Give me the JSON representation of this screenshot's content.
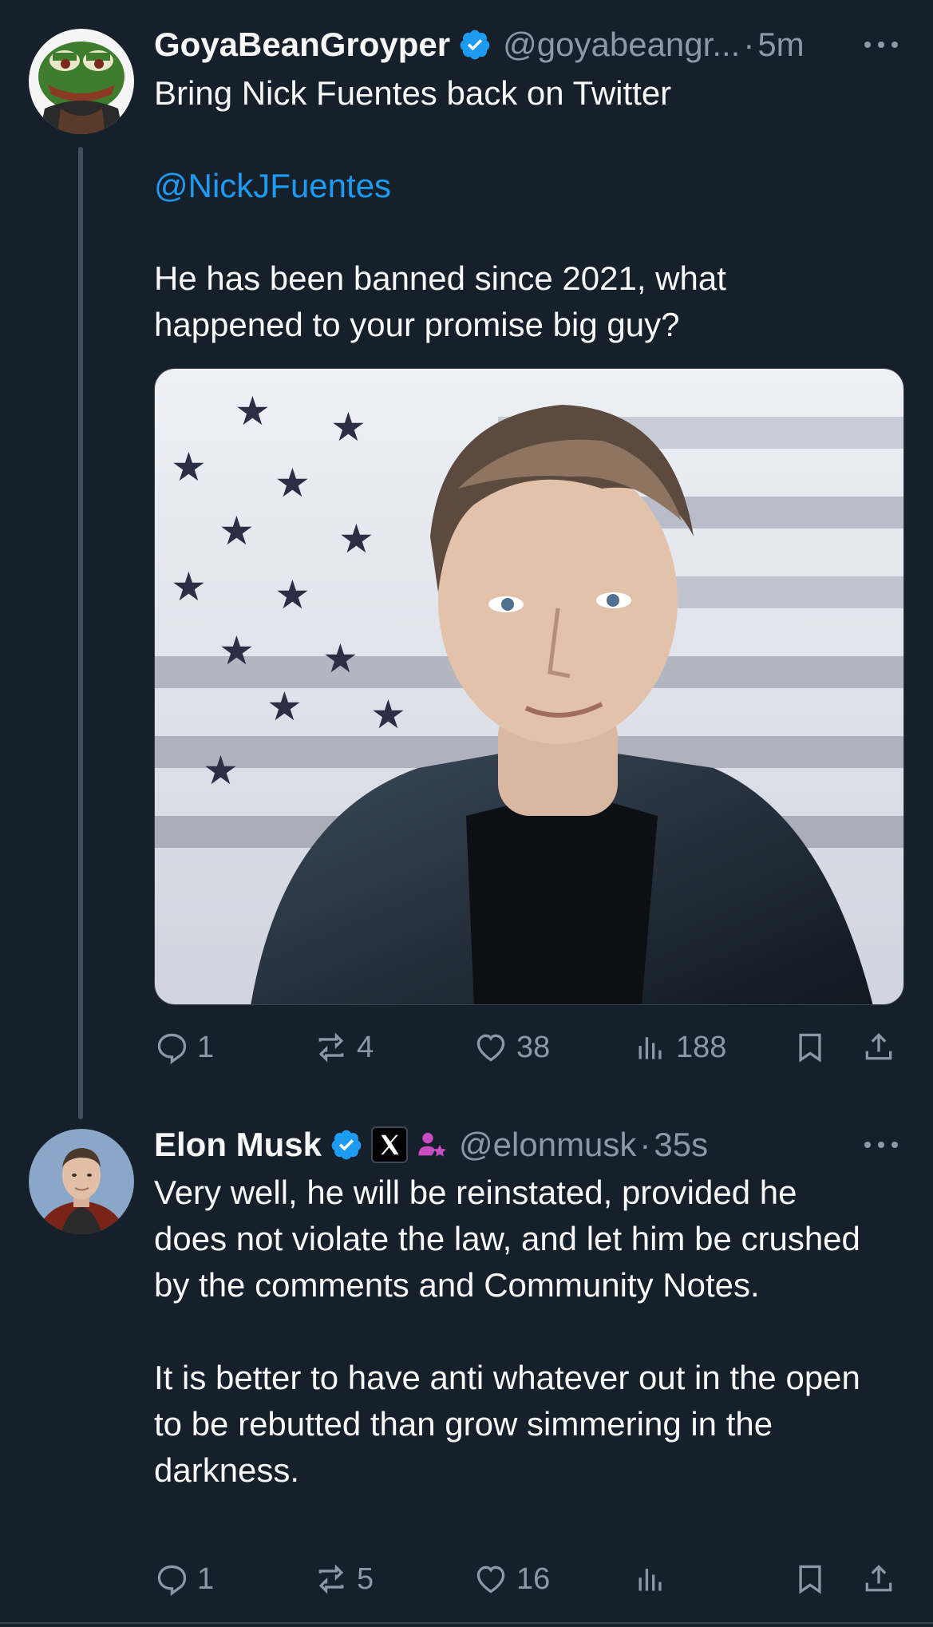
{
  "tweets": [
    {
      "display_name": "GoyaBeanGroyper",
      "handle": "@goyabeangr...",
      "separator": "·",
      "time": "5m",
      "body": {
        "line1": "Bring Nick Fuentes back on Twitter",
        "mention": "@NickJFuentes",
        "line2": "He has been banned since 2021, what happened to your promise big guy?"
      },
      "actions": {
        "replies": "1",
        "reposts": "4",
        "likes": "38",
        "views": "188"
      }
    },
    {
      "display_name": "Elon Musk",
      "handle": "@elonmusk",
      "separator": "·",
      "time": "35s",
      "body": {
        "para1": "Very well, he will be reinstated, provided he does not violate the law, and let him be crushed by the comments and Community Notes.",
        "para2": "It is better to have anti whatever out in the open to be rebutted than grow simmering in the darkness."
      },
      "actions": {
        "replies": "1",
        "reposts": "5",
        "likes": "16",
        "views": ""
      }
    }
  ],
  "colors": {
    "background": "#15202b",
    "text": "#f7f9f9",
    "muted": "#8b98a5",
    "link": "#1d9bf0",
    "verified": "#1d9bf0",
    "affiliate": "#c94cc4"
  },
  "icons": [
    "more-icon",
    "verified-badge-icon",
    "x-logo-icon",
    "affiliate-badge-icon",
    "reply-icon",
    "repost-icon",
    "like-icon",
    "views-icon",
    "bookmark-icon",
    "share-icon"
  ]
}
